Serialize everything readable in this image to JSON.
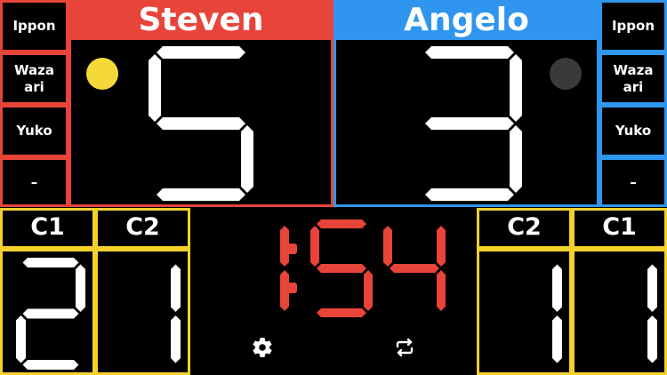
{
  "players": {
    "left": {
      "name": "Steven",
      "score": "5",
      "color": "#e8443a",
      "indicator_color": "#f5d93a"
    },
    "right": {
      "name": "Angelo",
      "score": "3",
      "color": "#2f95ee",
      "indicator_color": "#3a3a3a"
    }
  },
  "side_buttons": {
    "left": [
      "Ippon",
      "Waza\nari",
      "Yuko",
      "–"
    ],
    "right": [
      "Ippon",
      "Waza\nari",
      "Yuko",
      "–"
    ]
  },
  "penalties": {
    "left": [
      {
        "label": "C1",
        "value": "2"
      },
      {
        "label": "C2",
        "value": "1"
      }
    ],
    "right": [
      {
        "label": "C2",
        "value": "1"
      },
      {
        "label": "C1",
        "value": "1"
      }
    ]
  },
  "timer": {
    "minutes": "1",
    "seconds_tens": "5",
    "seconds_ones": "4",
    "color": "#e8443a"
  },
  "icons": {
    "settings": "gear-icon",
    "swap": "swap-icon"
  },
  "penalty_color": "#f5d12b"
}
